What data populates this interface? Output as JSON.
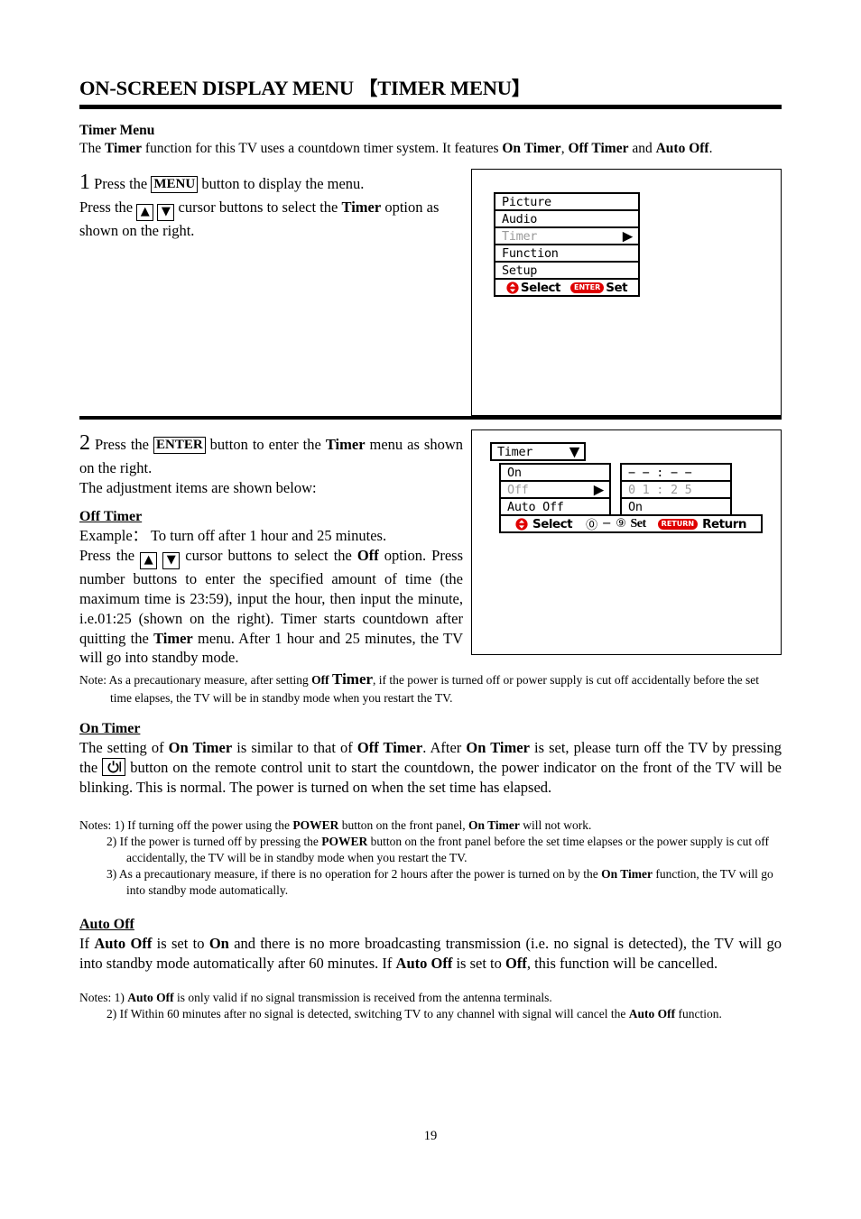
{
  "document": {
    "title": "ON-SCREEN DISPLAY MENU",
    "title_bracket_open": "【",
    "title_bracket_text": "TIMER MENU",
    "title_bracket_close": "】",
    "page_number": "19"
  },
  "intro": {
    "heading": "Timer Menu",
    "line_part1": "The ",
    "line_bold1": "Timer",
    "line_part2": " function for this TV uses a countdown timer system. It features ",
    "line_bold2": "On Timer",
    "line_part3": ", ",
    "line_bold3": "Off Timer",
    "line_part4": " and ",
    "line_bold4": "Auto Off",
    "line_part5": "."
  },
  "step1": {
    "number": "1",
    "text_a": "Press the ",
    "key_menu": "MENU",
    "text_b": " button to display the menu.",
    "text_c": "Press the ",
    "key_up": "▲",
    "key_down": "▼",
    "text_d": " cursor buttons to select the ",
    "bold_timer": "Timer",
    "text_e": " option as shown on the right."
  },
  "osd_main_menu": {
    "items": [
      {
        "label": "Picture",
        "dim": false,
        "arrow": ""
      },
      {
        "label": "Audio",
        "dim": false,
        "arrow": ""
      },
      {
        "label": "Timer",
        "dim": true,
        "arrow": "▶"
      },
      {
        "label": "Function",
        "dim": false,
        "arrow": ""
      },
      {
        "label": "Setup",
        "dim": false,
        "arrow": ""
      }
    ],
    "hint": {
      "select_label": "Select",
      "enter_badge": "ENTER",
      "set_label": "Set"
    }
  },
  "step2": {
    "number": "2",
    "text_a": "Press the ",
    "key_enter": "ENTER",
    "text_b": " button to enter the ",
    "bold_timer": "Timer",
    "text_c": " menu as shown on the right.",
    "text_d": "The adjustment items are shown below:"
  },
  "osd_timer_menu": {
    "title": "Timer",
    "title_arrow": "▼",
    "rows": [
      {
        "label": "On",
        "value": "− − : − −",
        "dim": false,
        "arrow": ""
      },
      {
        "label": "Off",
        "value": "0 1 : 2 5",
        "dim": true,
        "arrow": "▶"
      },
      {
        "label": "Auto Off",
        "value": "On",
        "dim": false,
        "arrow": ""
      }
    ],
    "hint": {
      "select_label": "Select",
      "digits_from": "⓪",
      "digits_dash": "−",
      "digits_to": "⑨",
      "set_label": "Set",
      "return_badge": "RETURN",
      "return_label": "Return"
    }
  },
  "off_timer": {
    "heading": "Off Timer",
    "example_label": "Example：",
    "example_text": "  To turn off after 1 hour and 25 minutes.",
    "body_a": "Press the ",
    "key_up": "▲",
    "key_down": "▼",
    "body_b": " cursor buttons to select the ",
    "bold_off": "Off",
    "body_c": " option. Press number buttons to enter the specified amount of time (the maximum time is 23:59), input the hour, then input the minute, i.e.01:25 (shown on the right). Timer starts countdown after quitting the ",
    "bold_timer": "Timer",
    "body_d": " menu. After 1 hour and 25 minutes, the TV will go into standby mode."
  },
  "off_timer_note": {
    "prefix": "Note: ",
    "text_a": "As a precautionary measure, after setting ",
    "bold_off": "Off ",
    "bold_timer_big": "Timer",
    "text_b": ", if the power is turned off or power supply is cut off accidentally before the set time elapses, the TV will be in standby mode when you restart the TV."
  },
  "on_timer": {
    "heading": "On Timer",
    "text_a": "The setting of ",
    "bold_on_timer_1": "On Timer",
    "text_b": " is similar to that of ",
    "bold_off_timer": "Off Timer",
    "text_c": ". After ",
    "bold_on_timer_2": "On Timer",
    "text_d": " is set, please turn off the TV by pressing the ",
    "power_icon": "power-icon",
    "text_e": " button on the remote control unit to start the countdown, the power indicator on the front of the TV will be blinking. This is normal. The power is turned on when the set time has elapsed."
  },
  "on_timer_notes": {
    "prefix": "Notes: ",
    "items": [
      {
        "num": "1) ",
        "a": "If turning off the power using the ",
        "b_bold": "POWER",
        "c": " button on the front panel, ",
        "d_bold": "On Timer",
        "e": " will not work."
      },
      {
        "num": "2) ",
        "a": "If the power is turned off by pressing the ",
        "b_bold": "POWER",
        "c": " button on the front panel before the set time elapses or the power supply is cut off accidentally, the TV will be in standby mode when you restart the TV.",
        "d_bold": "",
        "e": ""
      },
      {
        "num": "3) ",
        "a": "As a precautionary measure, if there is no operation for 2 hours after the power is turned on by the ",
        "b_bold": "On Timer",
        "c": " function, the TV will go into standby mode automatically.",
        "d_bold": "",
        "e": ""
      }
    ]
  },
  "auto_off": {
    "heading": "Auto Off",
    "text_a": "If ",
    "bold_auto_off_1": "Auto Off",
    "text_b": " is set to ",
    "bold_on": "On",
    "text_c": " and there is no more broadcasting transmission (i.e. no signal is detected), the TV will go into standby mode automatically after 60 minutes. If ",
    "bold_auto_off_2": "Auto Off",
    "text_d": " is set to ",
    "bold_off": "Off",
    "text_e": ", this function will be cancelled."
  },
  "auto_off_notes": {
    "prefix": "Notes: ",
    "item1_num": "1) ",
    "item1_bold": "Auto Off",
    "item1_text": " is only valid if no signal transmission is received from the antenna terminals.",
    "item2_num": "2) ",
    "item2_text_a": "If Within 60 minutes after no signal is detected, switching TV to any channel with signal will cancel the ",
    "item2_bold": "Auto Off",
    "item2_text_b": " function."
  },
  "colors": {
    "accent_red": "#e00000",
    "dim_gray": "#9a9a9a",
    "ink": "#000000"
  }
}
